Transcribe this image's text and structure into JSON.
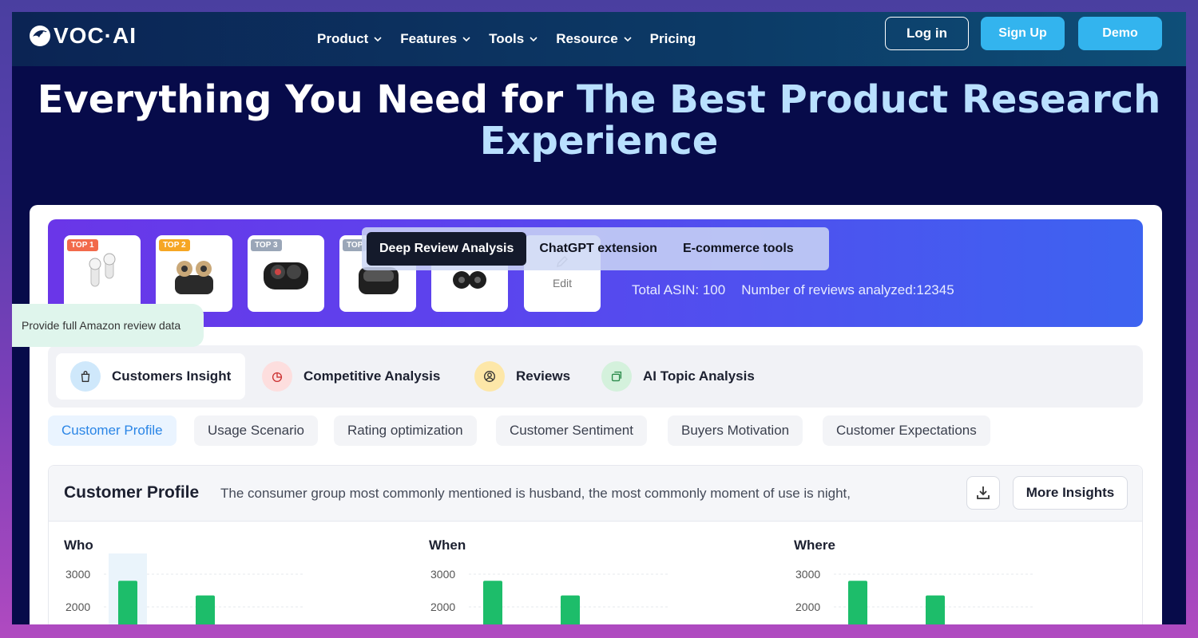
{
  "nav": {
    "logo": "VOC·AI",
    "menu": [
      {
        "label": "Product",
        "dropdown": true
      },
      {
        "label": "Features",
        "dropdown": true
      },
      {
        "label": "Tools",
        "dropdown": true
      },
      {
        "label": "Resource",
        "dropdown": true
      },
      {
        "label": "Pricing",
        "dropdown": false
      }
    ],
    "login_label": "Log in",
    "signup_label": "Sign Up",
    "demo_label": "Demo"
  },
  "hero": {
    "line1_white": "Everything You Need for ",
    "line1_blue": "The Best Product Research",
    "line2_blue": "Experience"
  },
  "banner": {
    "products": [
      {
        "badge": "TOP 1",
        "badge_color": "#f26a4b",
        "icon": "white-earbuds-icon"
      },
      {
        "badge": "TOP 2",
        "badge_color": "#f6a623",
        "icon": "gold-earbuds-icon"
      },
      {
        "badge": "TOP 3",
        "badge_color": "#9aa6b8",
        "icon": "black-earbuds-case-icon"
      },
      {
        "badge": "TOP",
        "badge_color": "#9aa6b8",
        "icon": "black-earbuds-icon"
      },
      {
        "badge": "",
        "badge_color": "",
        "icon": "black-earbuds-pair-icon"
      }
    ],
    "edit_label": "Edit",
    "total_asin": "Total ASIN: 100",
    "reviews_analyzed": "Number of reviews analyzed:12345"
  },
  "floating_tabs": [
    {
      "label": "Deep Review Analysis",
      "active": true
    },
    {
      "label": "ChatGPT extension",
      "active": false
    },
    {
      "label": "E-commerce tools",
      "active": false
    }
  ],
  "tooltip": "Provide full Amazon review data",
  "main_tabs": [
    {
      "label": "Customers Insight",
      "icon": "shopping-bag-icon",
      "icon_bg": "#cfe8fb",
      "active": true
    },
    {
      "label": "Competitive Analysis",
      "icon": "pie-chart-icon",
      "icon_bg": "#fddede",
      "active": false
    },
    {
      "label": "Reviews",
      "icon": "user-circle-icon",
      "icon_bg": "#fde7a8",
      "active": false
    },
    {
      "label": "AI Topic Analysis",
      "icon": "layers-icon",
      "icon_bg": "#d4f1dc",
      "active": false
    }
  ],
  "sub_tabs": [
    {
      "label": "Customer Profile",
      "active": true
    },
    {
      "label": "Usage Scenario",
      "active": false
    },
    {
      "label": "Rating optimization",
      "active": false
    },
    {
      "label": "Customer Sentiment",
      "active": false
    },
    {
      "label": "Buyers Motivation",
      "active": false
    },
    {
      "label": "Customer Expectations",
      "active": false
    }
  ],
  "panel": {
    "title": "Customer Profile",
    "description": "The consumer group most commonly mentioned is husband, the most commonly moment of use is night,",
    "more_label": "More Insights"
  },
  "chart_data": [
    {
      "type": "bar",
      "title": "Who",
      "y_ticks": [
        "3000",
        "2000"
      ],
      "values": [
        2800,
        2350
      ],
      "highlight_first": true
    },
    {
      "type": "bar",
      "title": "When",
      "y_ticks": [
        "3000",
        "2000"
      ],
      "values": [
        2800,
        2350
      ],
      "highlight_first": false
    },
    {
      "type": "bar",
      "title": "Where",
      "y_ticks": [
        "3000",
        "2000"
      ],
      "values": [
        2800,
        2350
      ],
      "highlight_first": false
    }
  ],
  "colors": {
    "bar": "#1dbd6a",
    "accent": "#33b4ee"
  }
}
